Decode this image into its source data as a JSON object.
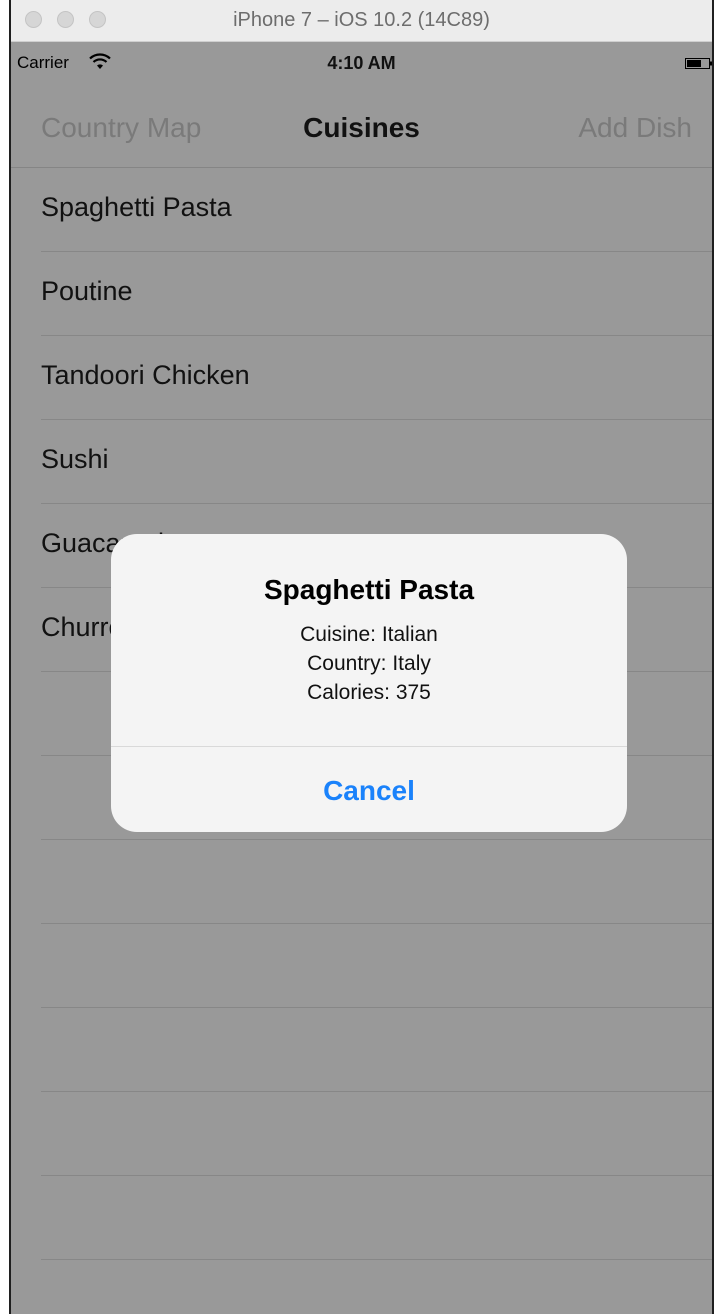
{
  "window": {
    "title": "iPhone 7 – iOS 10.2 (14C89)"
  },
  "statusbar": {
    "carrier": "Carrier",
    "time": "4:10 AM"
  },
  "navbar": {
    "left": "Country Map",
    "title": "Cuisines",
    "right": "Add Dish"
  },
  "list": {
    "items": [
      {
        "label": "Spaghetti Pasta"
      },
      {
        "label": "Poutine"
      },
      {
        "label": "Tandoori Chicken"
      },
      {
        "label": "Sushi"
      },
      {
        "label": "Guacamole"
      },
      {
        "label": "Churros"
      }
    ]
  },
  "alert": {
    "title": "Spaghetti Pasta",
    "cuisine": "Cuisine: Italian",
    "country": "Country: Italy",
    "calories": "Calories: 375",
    "cancel_label": "Cancel"
  },
  "colors": {
    "accent": "#1a82fb",
    "dim_background": "#999999",
    "alert_background": "#f4f4f4"
  }
}
